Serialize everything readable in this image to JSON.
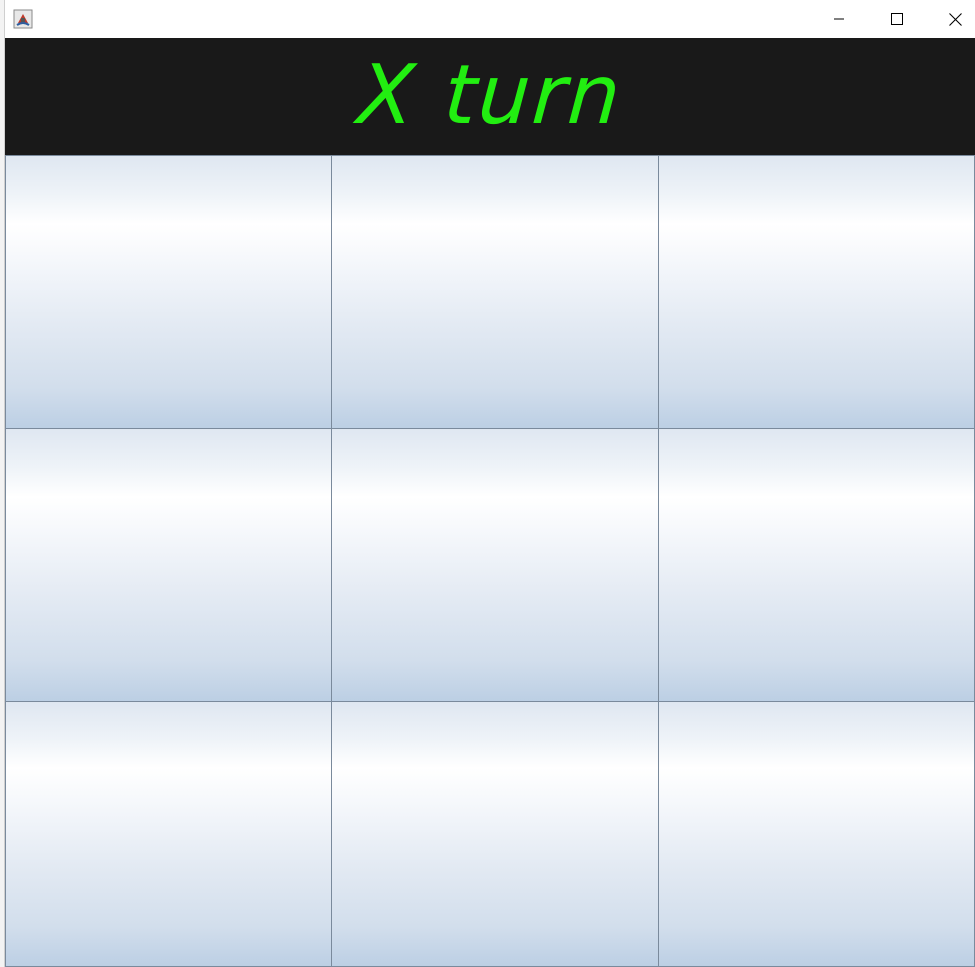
{
  "window": {
    "title": "",
    "icon": "java-app-icon",
    "controls": {
      "minimize": "minimize-icon",
      "maximize": "maximize-icon",
      "close": "close-icon"
    }
  },
  "header": {
    "status_text": "X turn",
    "status_color": "#22ee11",
    "background": "#191919"
  },
  "board": {
    "rows": 3,
    "cols": 3,
    "cells": [
      "",
      "",
      "",
      "",
      "",
      "",
      "",
      "",
      ""
    ]
  }
}
